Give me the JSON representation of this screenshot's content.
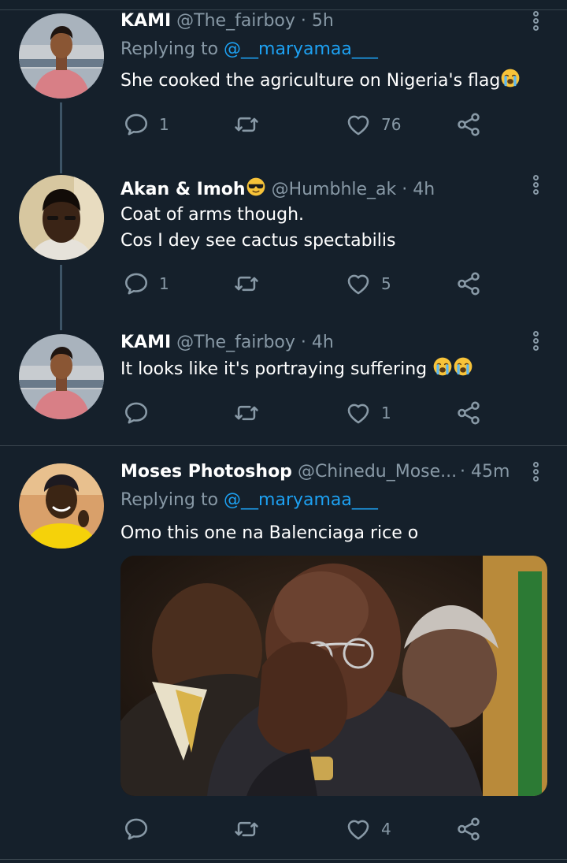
{
  "tweets": [
    {
      "name": "KAMI",
      "handle": "@The_fairboy",
      "time": "· 5h",
      "replying_prefix": "Replying to",
      "replying_to": "@__maryamaa___",
      "text": "She cooked the agriculture on Nigeria's flag",
      "text_emoji": "loudly-crying-face",
      "replies": "1",
      "likes": "76"
    },
    {
      "name": "Akan & Imoh",
      "name_emoji": "smiling-face-with-sunglasses",
      "handle": "@Humbhle_ak",
      "time": "· 4h",
      "text_line1": "Coat of arms though.",
      "text_line2": "Cos I dey see cactus spectabilis",
      "replies": "1",
      "likes": "5"
    },
    {
      "name": "KAMI",
      "handle": "@The_fairboy",
      "time": "· 4h",
      "text": "It looks like it's portraying suffering",
      "text_emoji": "loudly-crying-face x2",
      "replies": "",
      "likes": "1"
    },
    {
      "name": "Moses Photoshop",
      "handle": "@Chinedu_Mose...",
      "time": "· 45m",
      "replying_prefix": "Replying to",
      "replying_to": "@__maryamaa___",
      "text": "Omo this one na Balenciaga rice o",
      "replies": "",
      "likes": "4"
    }
  ],
  "colors": {
    "background": "#15202b",
    "secondary_text": "#8899a6",
    "link": "#1da1f2",
    "divider": "#38444d"
  }
}
